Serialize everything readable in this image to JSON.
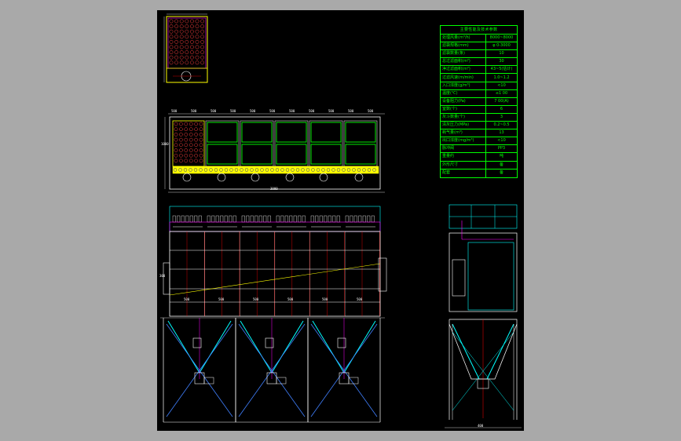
{
  "spec_table": {
    "title": "主要性能及技术参数",
    "rows": [
      {
        "name": "处理风量(m³/h)",
        "value": "8000~8000"
      },
      {
        "name": "滤袋规格(mm)",
        "value": "φ 0-3000"
      },
      {
        "name": "滤袋数量(条)",
        "value": "10"
      },
      {
        "name": "总过滤面积(m²)",
        "value": "30"
      },
      {
        "name": "净过滤面积(m²)",
        "value": "43~5(估计)"
      },
      {
        "name": "过滤风速(m/min)",
        "value": "1.0~1.2"
      },
      {
        "name": "入口浓度(g/m³)",
        "value": "<10"
      },
      {
        "name": "温度(℃)",
        "value": "≤1 00"
      },
      {
        "name": "设备阻力(Pa)",
        "value": "7 00(A)"
      },
      {
        "name": "室数(个)",
        "value": "6"
      },
      {
        "name": "灰斗数量(个)",
        "value": "3"
      },
      {
        "name": "清灰压力(MPa)",
        "value": "0.2~0.5"
      },
      {
        "name": "耗气量(m³)",
        "value": "13"
      },
      {
        "name": "出口浓度(mg/m³)",
        "value": "<10"
      },
      {
        "name": "脉冲阀",
        "value": "PP3"
      },
      {
        "name": "重量约",
        "value": "吨"
      },
      {
        "name": "外形尺寸",
        "value": "备"
      },
      {
        "name": "配套",
        "value": "备"
      }
    ]
  },
  "plan_view": {
    "dim_labels_top": [
      "500",
      "500",
      "500",
      "500",
      "500",
      "500",
      "500",
      "500",
      "500",
      "500",
      "500"
    ],
    "dim_label_bottom": "3000",
    "dim_label_left": "1000"
  },
  "front_view": {
    "dim_labels_mid": [
      "500",
      "500",
      "500",
      "500",
      "500",
      "500"
    ],
    "dim_label_side": "300"
  },
  "side_view": {
    "dim_label_bottom": "400"
  }
}
